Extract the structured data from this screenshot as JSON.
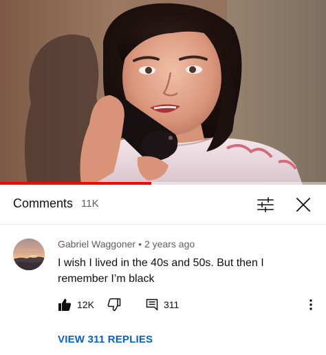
{
  "video": {
    "progress_fraction": 0.465
  },
  "comments_header": {
    "title": "Comments",
    "count": "11K",
    "filter_icon": "sort-filter-icon",
    "close_icon": "close-icon"
  },
  "comment": {
    "author": "Gabriel Waggoner",
    "separator": "•",
    "time": "2 years ago",
    "text": "I wish I lived in the 40s and 50s. But then I remember I’m black",
    "likes": "12K",
    "replies": "311",
    "view_replies": "VIEW 311 REPLIES",
    "icons": {
      "like": "thumbs-up-icon",
      "dislike": "thumbs-down-icon",
      "reply": "comment-reply-icon",
      "more": "more-vertical-icon"
    }
  },
  "colors": {
    "progress": "#ff0000",
    "link": "#065fd4",
    "secondary_text": "#606060",
    "primary_text": "#0f0f0f"
  }
}
